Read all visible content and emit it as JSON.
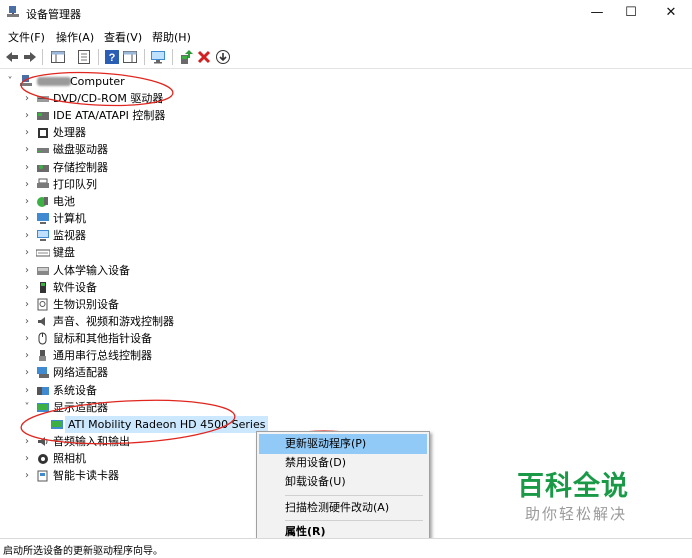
{
  "window": {
    "title": "设备管理器",
    "minimize_glyph": "—",
    "maximize_glyph": "☐",
    "close_glyph": "✕"
  },
  "menu": [
    "文件(F)",
    "操作(A)",
    "查看(V)",
    "帮助(H)"
  ],
  "toolbar": {
    "icons": [
      "back-icon",
      "forward-icon",
      "show-hide-console-tree-icon",
      "properties-icon",
      "help-icon",
      "show-action-pane-icon",
      "scan-monitor-icon",
      "update-driver-icon",
      "uninstall-icon",
      "download-driver-icon"
    ]
  },
  "tree": {
    "root": "Computer",
    "items": [
      {
        "label": "DVD/CD-ROM 驱动器",
        "icon": "dvd-drive-icon",
        "expanded": false
      },
      {
        "label": "IDE ATA/ATAPI 控制器",
        "icon": "ide-controller-icon",
        "expanded": false
      },
      {
        "label": "处理器",
        "icon": "processor-icon",
        "expanded": false
      },
      {
        "label": "磁盘驱动器",
        "icon": "disk-drive-icon",
        "expanded": false
      },
      {
        "label": "存储控制器",
        "icon": "storage-controller-icon",
        "expanded": false
      },
      {
        "label": "打印队列",
        "icon": "printer-icon",
        "expanded": false
      },
      {
        "label": "电池",
        "icon": "battery-icon",
        "expanded": false
      },
      {
        "label": "计算机",
        "icon": "computer-icon",
        "expanded": false
      },
      {
        "label": "监视器",
        "icon": "monitor-icon",
        "expanded": false
      },
      {
        "label": "键盘",
        "icon": "keyboard-icon",
        "expanded": false
      },
      {
        "label": "人体学输入设备",
        "icon": "hid-icon",
        "expanded": false
      },
      {
        "label": "软件设备",
        "icon": "software-device-icon",
        "expanded": false
      },
      {
        "label": "生物识别设备",
        "icon": "biometric-icon",
        "expanded": false
      },
      {
        "label": "声音、视频和游戏控制器",
        "icon": "sound-icon",
        "expanded": false
      },
      {
        "label": "鼠标和其他指针设备",
        "icon": "mouse-icon",
        "expanded": false
      },
      {
        "label": "通用串行总线控制器",
        "icon": "usb-icon",
        "expanded": false
      },
      {
        "label": "网络适配器",
        "icon": "network-adapter-icon",
        "expanded": false
      },
      {
        "label": "系统设备",
        "icon": "system-device-icon",
        "expanded": false
      },
      {
        "label": "显示适配器",
        "icon": "display-adapter-icon",
        "expanded": true
      },
      {
        "label": "ATI Mobility Radeon HD 4500 Series",
        "icon": "display-adapter-icon",
        "child": true
      },
      {
        "label": "音频输入和输出",
        "icon": "audio-io-icon",
        "expanded": false
      },
      {
        "label": "照相机",
        "icon": "camera-icon",
        "expanded": false
      },
      {
        "label": "智能卡读卡器",
        "icon": "smart-card-reader-icon",
        "expanded": false
      }
    ]
  },
  "context_menu": {
    "items": [
      "更新驱动程序(P)",
      "禁用设备(D)",
      "卸载设备(U)",
      "扫描检测硬件改动(A)",
      "属性(R)"
    ],
    "highlighted": "更新驱动程序(P)"
  },
  "status": "启动所选设备的更新驱动程序向导。",
  "watermark": {
    "title": "百科全说",
    "subtitle": "助你轻松解决"
  },
  "colors": {
    "selection": "#cce8ff",
    "menu_highlight": "#91c9f7",
    "annotation_red": "#e0261e",
    "watermark_green": "#1a9a47"
  }
}
